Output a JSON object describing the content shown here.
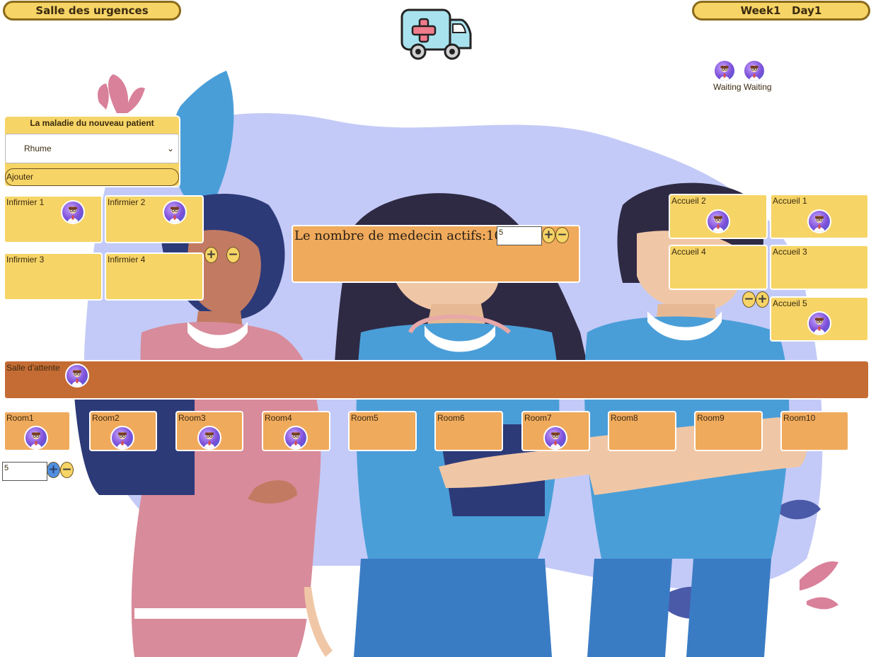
{
  "header": {
    "title": "Salle des urgences",
    "week_day": "Week1   Day1",
    "logo_icon": "ambulance-icon"
  },
  "waiting_queue": [
    {
      "label": "Waiting",
      "icon": "patient-avatar-icon"
    },
    {
      "label": "Waiting",
      "icon": "patient-avatar-icon"
    }
  ],
  "new_patient": {
    "title": "La maladie du nouveau patient",
    "selected_disease": "Rhume",
    "add_label": "Ajouter"
  },
  "nurses": [
    {
      "label": "Infirmier 1",
      "occupied": true
    },
    {
      "label": "Infirmier 2",
      "occupied": true
    },
    {
      "label": "Infirmier 3",
      "occupied": false
    },
    {
      "label": "Infirmier 4",
      "occupied": false
    }
  ],
  "doctors": {
    "label": "Le nombre de medecin actifs:10",
    "input_value": "5"
  },
  "receptions": [
    {
      "label": "Accueil 1",
      "occupied": true
    },
    {
      "label": "Accueil 2",
      "occupied": true
    },
    {
      "label": "Accueil 3",
      "occupied": false
    },
    {
      "label": "Accueil 4",
      "occupied": false
    },
    {
      "label": "Accueil 5",
      "occupied": true
    }
  ],
  "waiting_room": {
    "label": "Salle d'attente",
    "patient_count": 1
  },
  "rooms": [
    {
      "label": "Room1",
      "occupied": true
    },
    {
      "label": "Room2",
      "occupied": true
    },
    {
      "label": "Room3",
      "occupied": true
    },
    {
      "label": "Room4",
      "occupied": true
    },
    {
      "label": "Room5",
      "occupied": false
    },
    {
      "label": "Room6",
      "occupied": false
    },
    {
      "label": "Room7",
      "occupied": true
    },
    {
      "label": "Room8",
      "occupied": false
    },
    {
      "label": "Room9",
      "occupied": false
    },
    {
      "label": "Room10",
      "occupied": false
    }
  ],
  "rooms_control": {
    "input_value": "5"
  },
  "buttons": {
    "plus": "+",
    "minus": "−"
  },
  "colors": {
    "panel_yellow": "#f6d466",
    "room_orange": "#f0aa5c",
    "waiting_room_brown": "#c46c34",
    "blob_lavender": "#c3caf7"
  }
}
